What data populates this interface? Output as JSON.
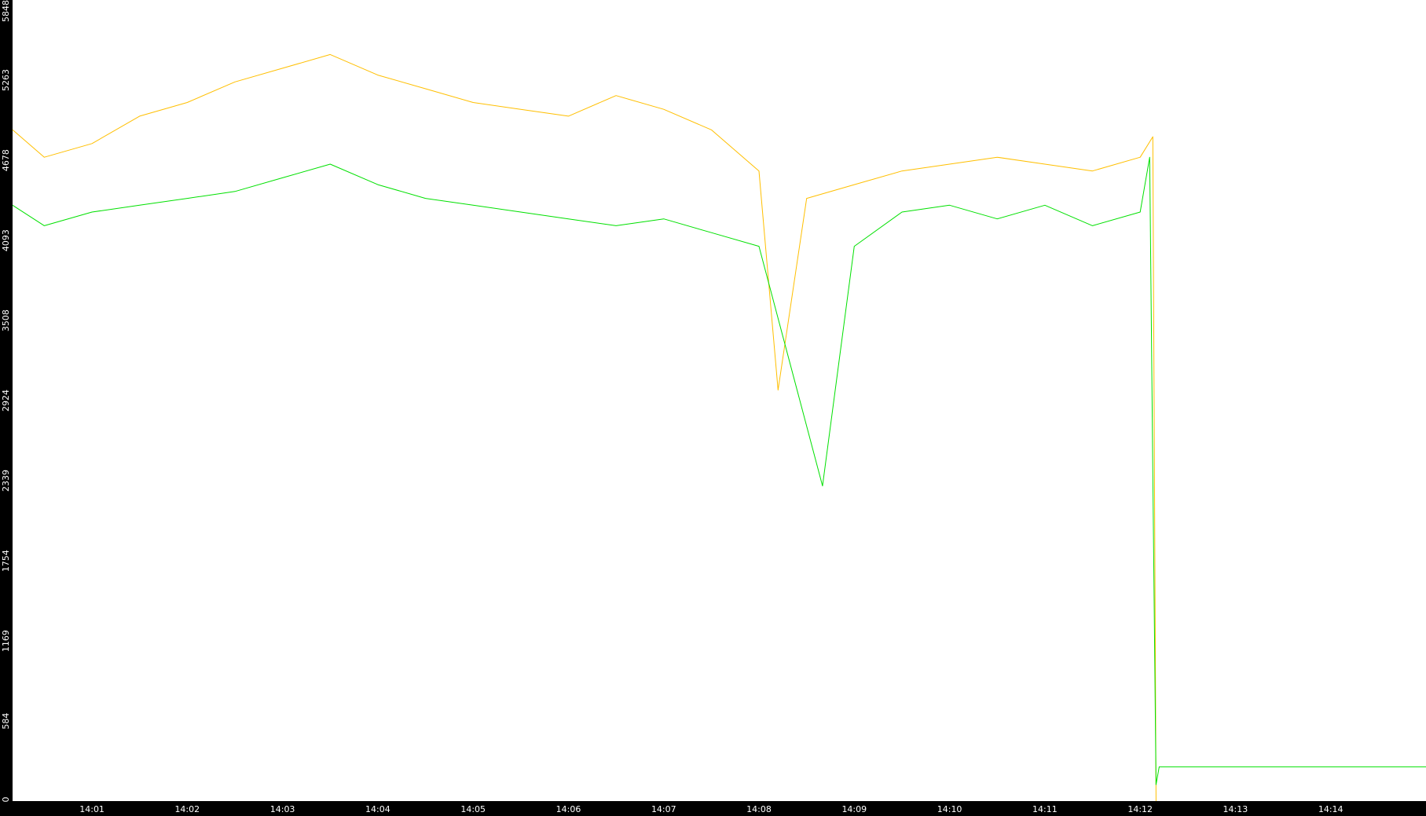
{
  "chart_data": {
    "type": "line",
    "title": "",
    "xlabel": "",
    "ylabel": "",
    "grid": false,
    "legend": "none",
    "colors": {
      "background": "#000000",
      "plot_area": "#ffffff",
      "axis_text": "#ffffff"
    },
    "y_ticks": [
      0,
      584,
      1169,
      1754,
      2339,
      2924,
      3508,
      4093,
      4678,
      5263,
      5848
    ],
    "ylim": [
      0,
      5848
    ],
    "x_ticks": [
      "14:01",
      "14:02",
      "14:03",
      "14:04",
      "14:05",
      "14:06",
      "14:07",
      "14:08",
      "14:09",
      "14:10",
      "14:11",
      "14:12",
      "14:13",
      "14:14"
    ],
    "xlim": [
      "14:00:10",
      "14:15:00"
    ],
    "series": [
      {
        "color": "#ffbf00",
        "x": [
          "14:00:10",
          "14:00:30",
          "14:01:00",
          "14:01:30",
          "14:02:00",
          "14:02:30",
          "14:03:00",
          "14:03:30",
          "14:04:00",
          "14:04:30",
          "14:05:00",
          "14:05:30",
          "14:06:00",
          "14:06:30",
          "14:07:00",
          "14:07:30",
          "14:08:00",
          "14:08:12",
          "14:08:30",
          "14:09:00",
          "14:09:30",
          "14:10:00",
          "14:10:30",
          "14:11:00",
          "14:11:30",
          "14:12:00",
          "14:12:08",
          "14:12:10"
        ],
        "values": [
          4900,
          4700,
          4800,
          5000,
          5100,
          5250,
          5350,
          5450,
          5300,
          5200,
          5100,
          5050,
          5000,
          5150,
          5050,
          4900,
          4600,
          3000,
          4400,
          4500,
          4600,
          4650,
          4700,
          4650,
          4600,
          4700,
          4850,
          0
        ]
      },
      {
        "color": "#00e000",
        "x": [
          "14:00:10",
          "14:00:30",
          "14:01:00",
          "14:01:30",
          "14:02:00",
          "14:02:30",
          "14:03:00",
          "14:03:30",
          "14:04:00",
          "14:04:30",
          "14:05:00",
          "14:05:30",
          "14:06:00",
          "14:06:30",
          "14:07:00",
          "14:07:30",
          "14:08:00",
          "14:08:40",
          "14:09:00",
          "14:09:30",
          "14:10:00",
          "14:10:30",
          "14:11:00",
          "14:11:30",
          "14:12:00",
          "14:12:06",
          "14:12:08",
          "14:12:10",
          "14:12:12",
          "14:15:00"
        ],
        "values": [
          4350,
          4200,
          4300,
          4350,
          4400,
          4450,
          4550,
          4650,
          4500,
          4400,
          4350,
          4300,
          4250,
          4200,
          4250,
          4150,
          4050,
          2300,
          4050,
          4300,
          4350,
          4250,
          4350,
          4200,
          4300,
          4700,
          2400,
          120,
          250,
          250
        ]
      }
    ]
  }
}
